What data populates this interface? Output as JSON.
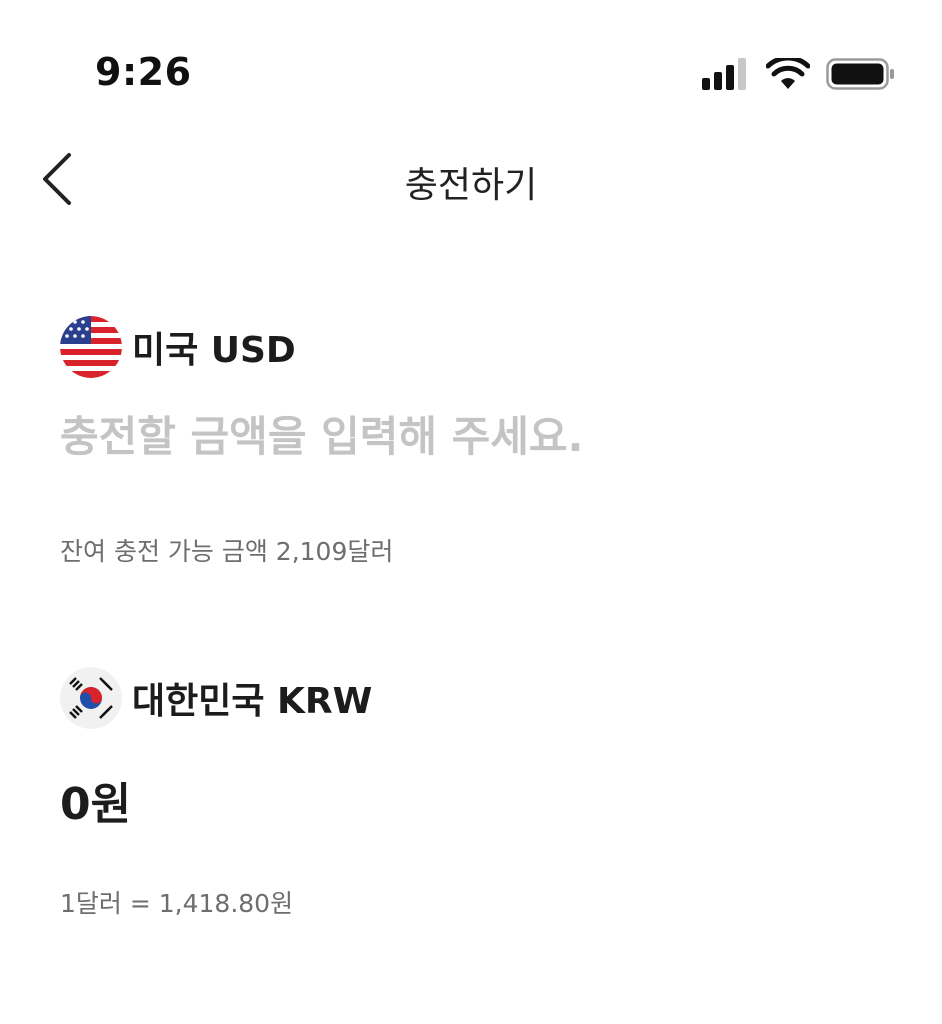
{
  "status_bar": {
    "time": "9:26"
  },
  "nav": {
    "title": "충전하기"
  },
  "usd": {
    "label": "미국 USD",
    "amount_value": "",
    "amount_placeholder": "충전할 금액을 입력해 주세요.",
    "remaining": "잔여 충전 가능 금액 2,109달러"
  },
  "krw": {
    "label": "대한민국 KRW",
    "amount": "0원",
    "rate": "1달러 = 1,418.80원"
  },
  "icons": {
    "back": "chevron-left-icon",
    "signal": "cellular-signal-icon",
    "wifi": "wifi-icon",
    "battery": "battery-icon",
    "usd_flag": "us-flag-icon",
    "krw_flag": "kr-flag-icon"
  },
  "colors": {
    "placeholder": "#c4c4c4",
    "secondary_text": "#6e6e6e",
    "primary_text": "#1c1c1c"
  }
}
